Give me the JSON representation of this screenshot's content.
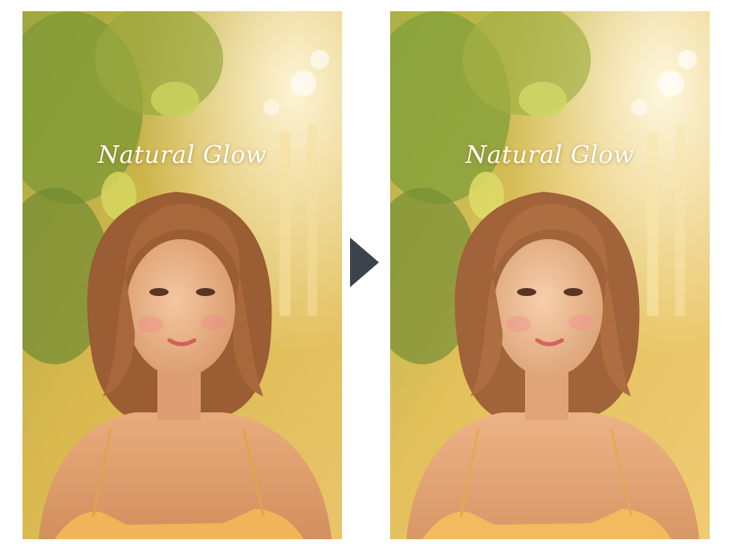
{
  "panels": [
    {
      "id": "before",
      "caption": "Natural Glow"
    },
    {
      "id": "after",
      "caption": "Natural Glow"
    }
  ],
  "arrow": {
    "icon": "chevron-right-icon",
    "color": "#3d434d"
  },
  "colors": {
    "background_warm": "#e6b845",
    "foliage": "#7d9a3a",
    "hair": "#a8683c",
    "skin": "#eab58c",
    "dress": "#f2b458"
  }
}
